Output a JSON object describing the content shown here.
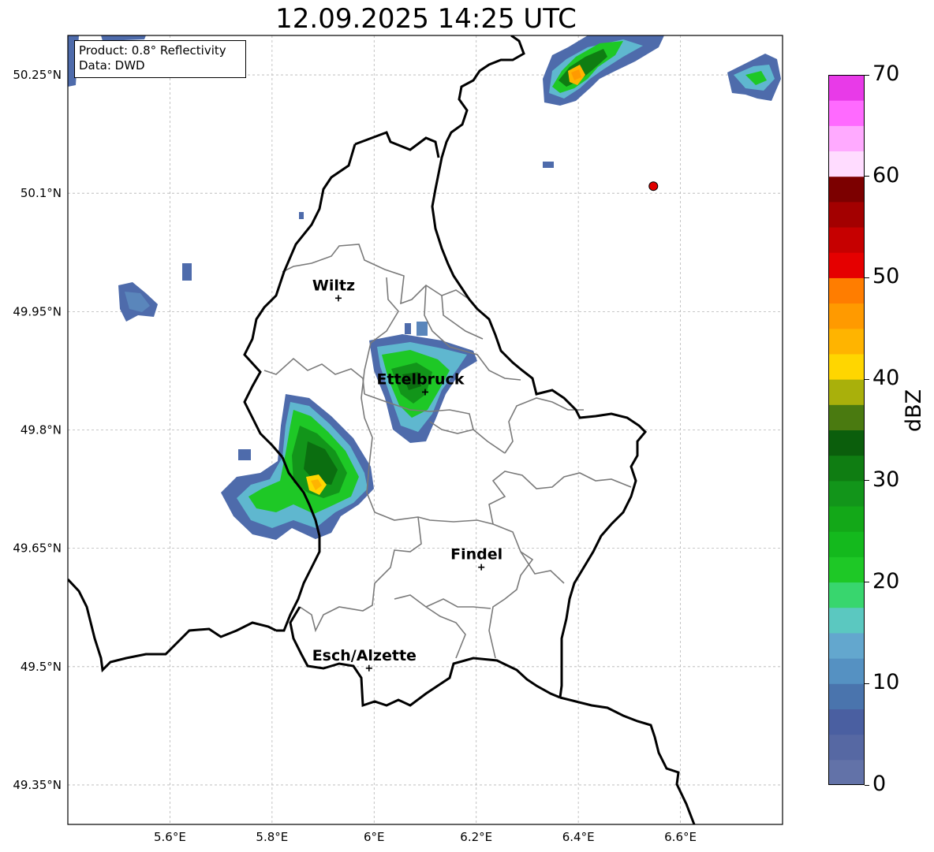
{
  "title": "12.09.2025 14:25 UTC",
  "info": {
    "product_line": "Product: 0.8° Reflectivity",
    "data_line": "Data: DWD"
  },
  "axes": {
    "lat_labels": [
      "50.25°N",
      "50.1°N",
      "49.95°N",
      "49.8°N",
      "49.65°N",
      "49.5°N",
      "49.35°N"
    ],
    "lat_values": [
      50.25,
      50.1,
      49.95,
      49.8,
      49.65,
      49.5,
      49.35
    ],
    "lon_labels": [
      "5.6°E",
      "5.8°E",
      "6°E",
      "6.2°E",
      "6.4°E",
      "6.6°E"
    ],
    "lon_values": [
      5.6,
      5.8,
      6.0,
      6.2,
      6.4,
      6.6
    ],
    "lon_range": [
      5.4,
      6.8
    ],
    "lat_range": [
      49.3,
      50.3
    ],
    "grid": true
  },
  "places": [
    {
      "name": "Wiltz",
      "lon": 5.93,
      "lat": 49.967
    },
    {
      "name": "Ettelbruck",
      "lon": 6.1,
      "lat": 49.848
    },
    {
      "name": "Findel",
      "lon": 6.21,
      "lat": 49.626
    },
    {
      "name": "Esch/Alzette",
      "lon": 5.99,
      "lat": 49.498
    }
  ],
  "radar_site": {
    "lon": 6.547,
    "lat": 50.109
  },
  "colorbar": {
    "label": "dBZ",
    "min": 0,
    "max": 70,
    "ticks": [
      "0",
      "10",
      "20",
      "30",
      "40",
      "50",
      "60",
      "70"
    ],
    "colors": [
      "#6272a8",
      "#5668a3",
      "#4a5fa1",
      "#4a74ad",
      "#5591c2",
      "#63a7ce",
      "#5bc8c0",
      "#38d66e",
      "#1ec826",
      "#14b91d",
      "#13a818",
      "#12951a",
      "#0f7d12",
      "#0b5e0c",
      "#4a7a10",
      "#a9b00b",
      "#ffd600",
      "#ffb400",
      "#ff9a00",
      "#ff7d00",
      "#e50000",
      "#c60000",
      "#a30000",
      "#7c0000",
      "#ffdcff",
      "#ffaaff",
      "#ff6aff",
      "#e83ae8"
    ]
  }
}
